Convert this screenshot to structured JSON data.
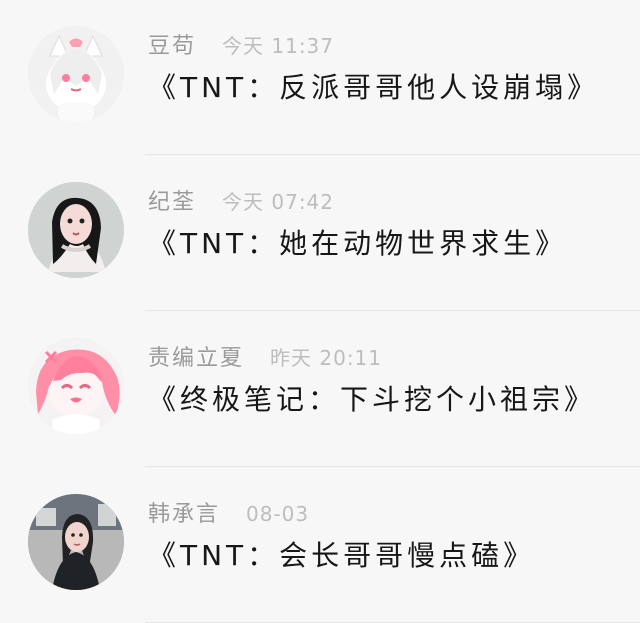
{
  "messages": [
    {
      "avatar_icon": "cat-girl-avatar-icon",
      "sender": "豆苟",
      "time": "今天 11:37",
      "text": "《TNT：反派哥哥他人设崩塌》"
    },
    {
      "avatar_icon": "woman-portrait-avatar-icon",
      "sender": "纪荃",
      "time": "今天 07:42",
      "text": "《TNT：她在动物世界求生》"
    },
    {
      "avatar_icon": "pink-hair-anime-avatar-icon",
      "sender": "责编立夏",
      "time": "昨天 20:11",
      "text": "《终极笔记：下斗挖个小祖宗》"
    },
    {
      "avatar_icon": "street-portrait-avatar-icon",
      "sender": "韩承言",
      "time": "08-03",
      "text": "《TNT：会长哥哥慢点磕》"
    }
  ]
}
